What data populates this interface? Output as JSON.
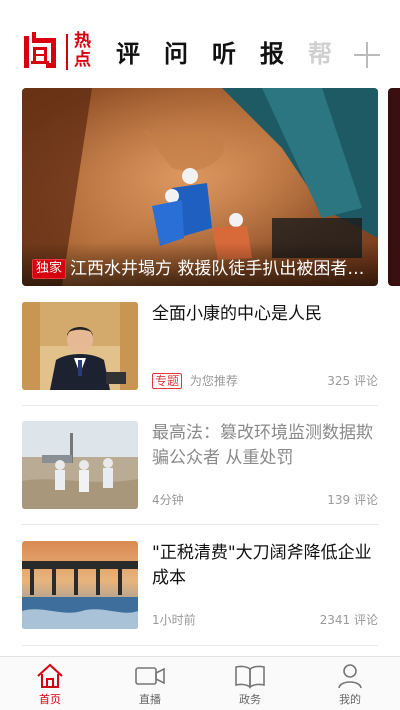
{
  "header": {
    "logo_main": "闻",
    "logo_sub": "热点",
    "tabs": [
      "评",
      "问",
      "听",
      "报",
      "帮"
    ],
    "add_tab_icon": "plus-icon"
  },
  "banner": {
    "tag": "独家",
    "title": "江西水井塌方 救援队徒手扒出被困者…"
  },
  "news": [
    {
      "title": "全面小康的中心是人民",
      "tag": "专题",
      "source": "为您推荐",
      "comments": "325 评论",
      "read": false
    },
    {
      "title": "最高法：篡改环境监测数据欺骗公众者 从重处罚",
      "tag": "",
      "source": "4分钟",
      "comments": "139 评论",
      "read": true
    },
    {
      "title": "\"正税清费\"大刀阔斧降低企业成本",
      "tag": "",
      "source": "1小时前",
      "comments": "2341 评论",
      "read": false
    }
  ],
  "tabbar": {
    "items": [
      {
        "label": "首页",
        "icon": "home-icon",
        "active": true
      },
      {
        "label": "直播",
        "icon": "video-camera-icon",
        "active": false
      },
      {
        "label": "政务",
        "icon": "open-book-icon",
        "active": false
      },
      {
        "label": "我的",
        "icon": "user-icon",
        "active": false
      }
    ]
  },
  "colors": {
    "brand_red": "#d7000f",
    "muted_text": "#999999"
  }
}
